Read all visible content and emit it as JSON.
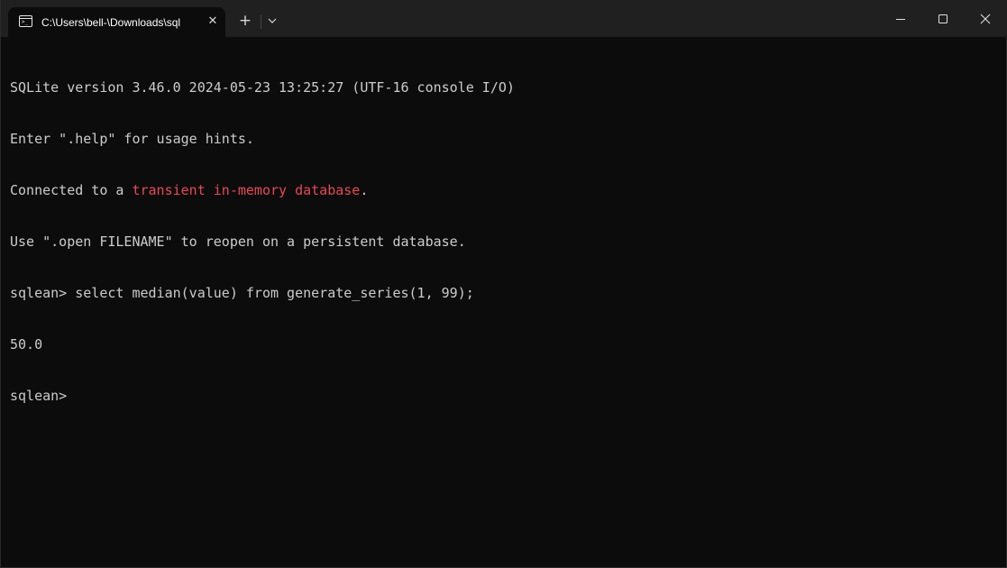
{
  "window": {
    "tab_title": "C:\\Users\\bell-\\Downloads\\sql",
    "tab_icon": "terminal-icon",
    "tab_close_glyph": "✕",
    "new_tab_glyph": "+",
    "controls": [
      "minimize-icon",
      "maximize-icon",
      "close-icon"
    ]
  },
  "terminal": {
    "line1": "SQLite version 3.46.0 2024-05-23 13:25:27 (UTF-16 console I/O)",
    "line2": "Enter \".help\" for usage hints.",
    "line3_prefix": "Connected to a ",
    "line3_highlight": "transient in-memory database",
    "line3_suffix": ".",
    "line4": "Use \".open FILENAME\" to reopen on a persistent database.",
    "line5": "sqlean> select median(value) from generate_series(1, 99);",
    "line6": "50.0",
    "line7": "sqlean>"
  },
  "colors": {
    "background": "#0c0c0c",
    "titlebar": "#202020",
    "text": "#cccccc",
    "highlight": "#e74856"
  }
}
